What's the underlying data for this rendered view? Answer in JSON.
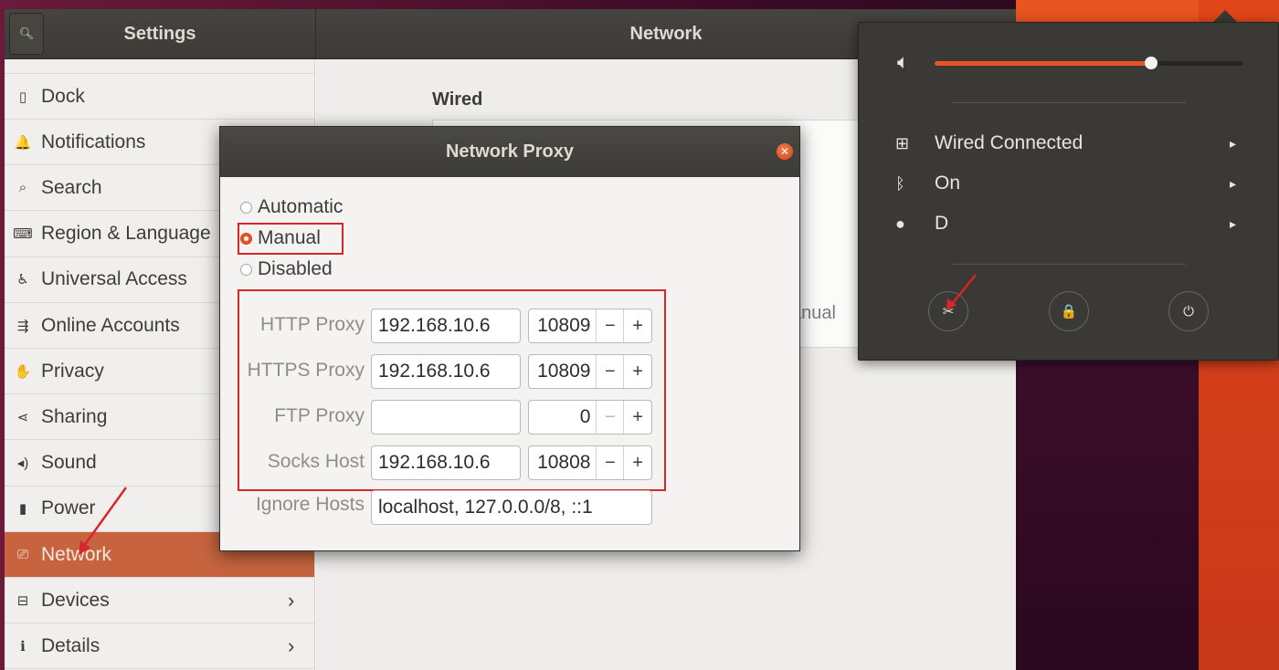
{
  "settings": {
    "title": "Settings",
    "search_icon": "search-icon",
    "sidebar": [
      {
        "label": "Dock",
        "icon": "dock-icon",
        "glyph": "▯"
      },
      {
        "label": "Notifications",
        "icon": "bell-icon",
        "glyph": "🔔"
      },
      {
        "label": "Search",
        "icon": "search-icon",
        "glyph": "⌕"
      },
      {
        "label": "Region & Language",
        "icon": "keyboard-icon",
        "glyph": "⌨"
      },
      {
        "label": "Universal Access",
        "icon": "accessibility-icon",
        "glyph": "♿"
      },
      {
        "label": "Online Accounts",
        "icon": "online-accounts-icon",
        "glyph": "⇶"
      },
      {
        "label": "Privacy",
        "icon": "hand-icon",
        "glyph": "✋"
      },
      {
        "label": "Sharing",
        "icon": "share-icon",
        "glyph": "⋖"
      },
      {
        "label": "Sound",
        "icon": "speaker-icon",
        "glyph": "◂)"
      },
      {
        "label": "Power",
        "icon": "battery-icon",
        "glyph": "▮"
      },
      {
        "label": "Network",
        "icon": "network-icon",
        "glyph": "⎚",
        "active": true
      },
      {
        "label": "Devices",
        "icon": "devices-icon",
        "glyph": "⊟",
        "chevron": "›"
      },
      {
        "label": "Details",
        "icon": "info-icon",
        "glyph": "ℹ",
        "chevron": "›"
      }
    ]
  },
  "network_page": {
    "title": "Network",
    "wired_heading": "Wired",
    "method_fragment": "anual"
  },
  "proxy_dialog": {
    "title": "Network Proxy",
    "modes": [
      {
        "label": "Automatic",
        "selected": false
      },
      {
        "label": "Manual",
        "selected": true
      },
      {
        "label": "Disabled",
        "selected": false
      }
    ],
    "proxies": [
      {
        "label": "HTTP Proxy",
        "host": "192.168.10.6",
        "port": "10809",
        "minus_enabled": true
      },
      {
        "label": "HTTPS Proxy",
        "host": "192.168.10.6",
        "port": "10809",
        "minus_enabled": true
      },
      {
        "label": "FTP Proxy",
        "host": "",
        "port": "0",
        "minus_enabled": false
      },
      {
        "label": "Socks Host",
        "host": "192.168.10.6",
        "port": "10808",
        "minus_enabled": true
      }
    ],
    "ignore_hosts_label": "Ignore Hosts",
    "ignore_hosts_value": "localhost, 127.0.0.0/8, ::1",
    "minus": "−",
    "plus": "+"
  },
  "system_menu": {
    "volume_level": 0.7,
    "volume_icon": "speaker-icon",
    "rows": [
      {
        "label": "Wired Connected",
        "icon": "network-wired-icon",
        "glyph": "⊞",
        "arrow": "▸"
      },
      {
        "label": "On",
        "icon": "bluetooth-icon",
        "glyph": "ᛒ",
        "arrow": "▸"
      },
      {
        "label": "D",
        "icon": "user-icon",
        "glyph": "●",
        "arrow": "▸"
      }
    ],
    "buttons": [
      {
        "icon": "settings-tools-icon",
        "glyph": "✂"
      },
      {
        "icon": "lock-icon",
        "glyph": "🔒"
      },
      {
        "icon": "power-icon",
        "glyph": "⏻"
      }
    ]
  },
  "colors": {
    "accent": "#e95420",
    "annotation": "#d72629",
    "active_sidebar": "#c7643f"
  }
}
